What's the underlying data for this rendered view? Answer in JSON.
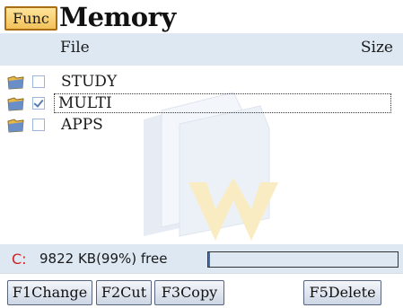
{
  "header": {
    "func_label": "Func",
    "title": "Memory"
  },
  "columns": {
    "file": "File",
    "size": "Size"
  },
  "files": [
    {
      "name": "STUDY",
      "checked": false,
      "selected": false
    },
    {
      "name": "MULTI",
      "checked": true,
      "selected": true
    },
    {
      "name": "APPS",
      "checked": false,
      "selected": false
    }
  ],
  "status": {
    "drive": "C:",
    "free_text": "9822 KB(99%) free",
    "used_fraction": 0.01
  },
  "softkeys": {
    "f1": "F1Change",
    "f2": "F2Cut",
    "f3": "F3Copy",
    "f5": "F5Delete"
  },
  "colors": {
    "header_band": "#dde8f3",
    "func_button": "#f2c15a",
    "drive_letter": "#cc2222",
    "folder": "#e8b84a"
  }
}
